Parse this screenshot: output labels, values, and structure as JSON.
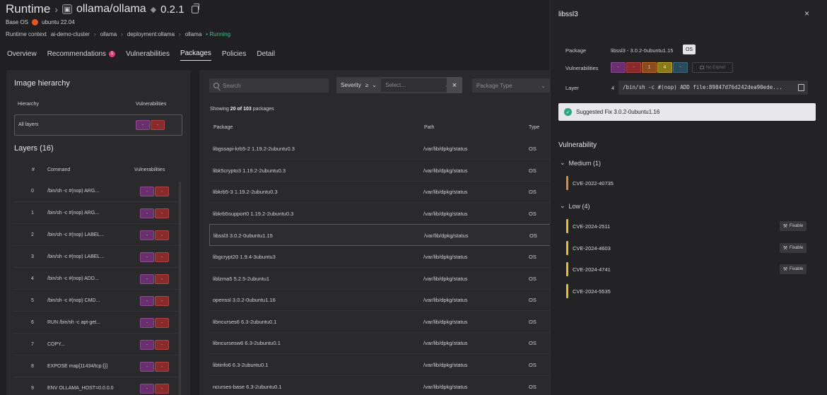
{
  "header": {
    "runtime": "Runtime",
    "image": "ollama/ollama",
    "version": "0.2.1",
    "base_os_label": "Base OS",
    "base_os_value": "ubuntu 22.04",
    "context_label": "Runtime context",
    "context_path": [
      "ai-demo-cluster",
      "ollama",
      "deployment:ollama",
      "ollama"
    ],
    "status": "Running"
  },
  "tabs": [
    {
      "label": "Overview"
    },
    {
      "label": "Recommendations",
      "badge": "1"
    },
    {
      "label": "Vulnerabilities"
    },
    {
      "label": "Packages",
      "active": true
    },
    {
      "label": "Policies"
    },
    {
      "label": "Detail"
    }
  ],
  "hierarchy": {
    "title": "Image hierarchy",
    "col_hierarchy": "Hierarchy",
    "col_vulns": "Vulnerabilities",
    "all_layers": "All layers",
    "layers_title": "Layers (16)",
    "col_num": "#",
    "col_command": "Command",
    "layers": [
      {
        "num": "0",
        "cmd": "/bin/sh -c #(nop) ARG..."
      },
      {
        "num": "1",
        "cmd": "/bin/sh -c #(nop) ARG..."
      },
      {
        "num": "2",
        "cmd": "/bin/sh -c #(nop) LABEL..."
      },
      {
        "num": "3",
        "cmd": "/bin/sh -c #(nop) LABEL..."
      },
      {
        "num": "4",
        "cmd": "/bin/sh -c #(nop) ADD..."
      },
      {
        "num": "5",
        "cmd": "/bin/sh -c #(nop) CMD..."
      },
      {
        "num": "6",
        "cmd": "RUN /bin/sh -c apt-get..."
      },
      {
        "num": "7",
        "cmd": "COPY..."
      },
      {
        "num": "8",
        "cmd": "EXPOSE map[11434/tcp:{}]"
      },
      {
        "num": "9",
        "cmd": "ENV OLLAMA_HOST=0.0.0.0"
      }
    ],
    "dash": "-"
  },
  "packages": {
    "search_placeholder": "Search",
    "severity_label": "Severity",
    "severity_op": "≥",
    "severity_placeholder": "Select...",
    "package_type_placeholder": "Package Type",
    "showing_prefix": "Showing ",
    "showing_count": "20 of 103",
    "showing_suffix": " packages",
    "col_package": "Package",
    "col_path": "Path",
    "col_type": "Type",
    "rows": [
      {
        "name": "libgssapi-krb5-2 1.19.2-2ubuntu0.3",
        "path": "/var/lib/dpkg/status",
        "type": "OS"
      },
      {
        "name": "libk5crypto3 1.19.2-2ubuntu0.3",
        "path": "/var/lib/dpkg/status",
        "type": "OS"
      },
      {
        "name": "libkrb5-3 1.19.2-2ubuntu0.3",
        "path": "/var/lib/dpkg/status",
        "type": "OS"
      },
      {
        "name": "libkrb5support0 1.19.2-2ubuntu0.3",
        "path": "/var/lib/dpkg/status",
        "type": "OS"
      },
      {
        "name": "libssl3 3.0.2-0ubuntu1.15",
        "path": "/var/lib/dpkg/status",
        "type": "OS"
      },
      {
        "name": "libgcrypt20 1.9.4-3ubuntu3",
        "path": "/var/lib/dpkg/status",
        "type": "OS"
      },
      {
        "name": "liblzma5 5.2.5-2ubuntu1",
        "path": "/var/lib/dpkg/status",
        "type": "OS"
      },
      {
        "name": "openssl 3.0.2-0ubuntu1.16",
        "path": "/var/lib/dpkg/status",
        "type": "OS"
      },
      {
        "name": "libncurses6 6.3-2ubuntu0.1",
        "path": "/var/lib/dpkg/status",
        "type": "OS"
      },
      {
        "name": "libncursesw6 6.3-2ubuntu0.1",
        "path": "/var/lib/dpkg/status",
        "type": "OS"
      },
      {
        "name": "libtinfo6 6.3-2ubuntu0.1",
        "path": "/var/lib/dpkg/status",
        "type": "OS"
      },
      {
        "name": "ncurses-base 6.3-2ubuntu0.1",
        "path": "/var/lib/dpkg/status",
        "type": "OS"
      }
    ]
  },
  "detail": {
    "title": "libssl3",
    "close": "×",
    "package_label": "Package",
    "package_value": "libssl3 - 3.0.2-0ubuntu1.15",
    "package_type": "OS",
    "vulns_label": "Vulnerabilities",
    "vuln_counts": {
      "critical": "-",
      "high": "-",
      "medium": "1",
      "low": "4",
      "unknown": "-"
    },
    "no_exploit": "No Exploit",
    "layer_label": "Layer",
    "layer_num": "4",
    "layer_cmd": "/bin/sh -c #(nop) ADD file:89847d76d242dea90ede...",
    "suggested_fix": "Suggested Fix 3.0.2-0ubuntu1.16",
    "vuln_title": "Vulnerability",
    "medium_group": "Medium (1)",
    "low_group": "Low (4)",
    "fixable": "Fixable",
    "medium_cves": [
      "CVE-2022-40735"
    ],
    "low_cves": [
      {
        "id": "CVE-2024-2511",
        "fixable": true
      },
      {
        "id": "CVE-2024-4603",
        "fixable": true
      },
      {
        "id": "CVE-2024-4741",
        "fixable": true
      },
      {
        "id": "CVE-2024-5535",
        "fixable": false
      }
    ]
  }
}
